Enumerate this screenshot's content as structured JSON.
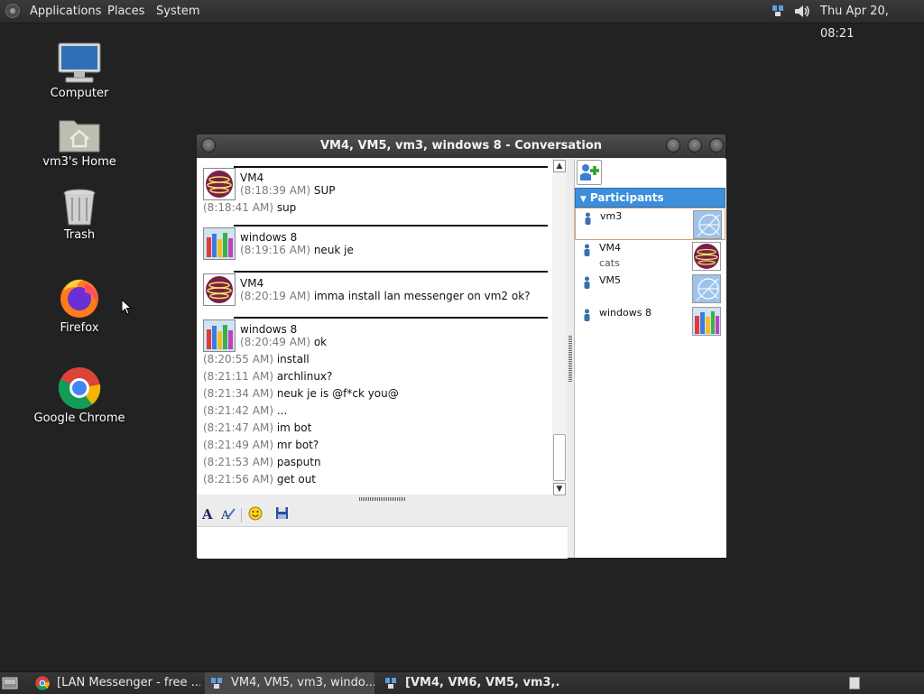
{
  "top_panel": {
    "menus": [
      "Applications",
      "Places",
      "System"
    ],
    "icons": [
      "network-icon",
      "volume-icon"
    ],
    "clock": "Thu Apr 20, 08:21"
  },
  "desktop": {
    "icons": [
      {
        "label": "Computer",
        "icon": "computer-icon"
      },
      {
        "label": "vm3's Home",
        "icon": "home-folder-icon"
      },
      {
        "label": "Trash",
        "icon": "trash-icon"
      },
      {
        "label": "Firefox",
        "icon": "firefox-icon"
      },
      {
        "label": "Google Chrome",
        "icon": "chrome-icon"
      }
    ]
  },
  "window": {
    "title": "VM4, VM5, vm3, windows 8 - Conversation",
    "messages": [
      {
        "sender": "VM4",
        "lines": [
          {
            "time": "(8:18:39 AM)",
            "text": "SUP"
          }
        ]
      },
      {
        "sender": null,
        "lines": [
          {
            "time": "(8:18:41 AM)",
            "text": "sup"
          }
        ]
      },
      {
        "sender": "windows 8",
        "lines": [
          {
            "time": "(8:19:16 AM)",
            "text": "neuk je"
          }
        ]
      },
      {
        "sender": "VM4",
        "lines": [
          {
            "time": "(8:20:19 AM)",
            "text": "imma install lan messenger on vm2 ok?"
          }
        ]
      },
      {
        "sender": "windows 8",
        "lines": [
          {
            "time": "(8:20:49 AM)",
            "text": "ok"
          },
          {
            "time": "(8:20:55 AM)",
            "text": "install"
          },
          {
            "time": "(8:21:11 AM)",
            "text": "archlinux?"
          },
          {
            "time": "(8:21:34 AM)",
            "text": "neuk je is @f*ck you@"
          },
          {
            "time": "(8:21:42 AM)",
            "text": "..."
          },
          {
            "time": "(8:21:47 AM)",
            "text": "im bot"
          },
          {
            "time": "(8:21:49 AM)",
            "text": "mr bot?"
          },
          {
            "time": "(8:21:53 AM)",
            "text": "pasputn"
          },
          {
            "time": "(8:21:56 AM)",
            "text": "get out"
          }
        ]
      }
    ],
    "toolbar_icons": [
      "font-icon",
      "font-color-icon",
      "smiley-icon",
      "save-icon"
    ],
    "participants_header": "Participants",
    "participants": [
      {
        "name": "vm3",
        "note": "",
        "selected": true
      },
      {
        "name": "VM4",
        "note": "cats",
        "selected": false
      },
      {
        "name": "VM5",
        "note": "",
        "selected": false
      },
      {
        "name": "windows 8",
        "note": "",
        "selected": false
      }
    ]
  },
  "taskbar": {
    "tasks": [
      {
        "label": "[LAN Messenger - free ...",
        "icon": "chrome-icon",
        "active": false,
        "bold": false
      },
      {
        "label": "VM4, VM5, vm3, windo...",
        "icon": "messenger-icon",
        "active": true,
        "bold": false
      },
      {
        "label": "[VM4, VM6, VM5, vm3,...",
        "icon": "messenger-icon",
        "active": false,
        "bold": true
      }
    ]
  },
  "colors": {
    "desktop_bg": "#222222",
    "participants_header": "#3c8fdc",
    "timestamp": "#7a7a7a"
  }
}
